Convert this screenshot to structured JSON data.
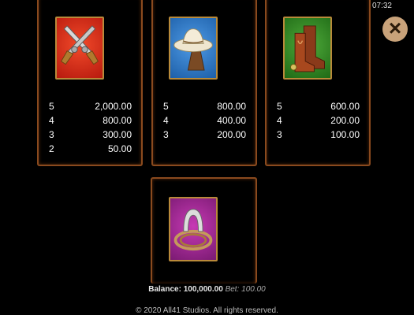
{
  "status": {
    "time": "07:32"
  },
  "close_label": "×",
  "colors": {
    "panel_border": "#8a4a1e",
    "close_bg": "#c8a27a"
  },
  "panels": [
    {
      "symbol": "crossed-pistols-icon",
      "payouts": [
        {
          "count": "5",
          "value": "2,000.00"
        },
        {
          "count": "4",
          "value": "800.00"
        },
        {
          "count": "3",
          "value": "300.00"
        },
        {
          "count": "2",
          "value": "50.00"
        }
      ]
    },
    {
      "symbol": "cowboy-hat-icon",
      "payouts": [
        {
          "count": "5",
          "value": "800.00"
        },
        {
          "count": "4",
          "value": "400.00"
        },
        {
          "count": "3",
          "value": "200.00"
        }
      ]
    },
    {
      "symbol": "cowboy-boots-icon",
      "payouts": [
        {
          "count": "5",
          "value": "600.00"
        },
        {
          "count": "4",
          "value": "200.00"
        },
        {
          "count": "3",
          "value": "100.00"
        }
      ]
    },
    {
      "symbol": "horseshoe-lasso-icon",
      "payouts": []
    }
  ],
  "footer": {
    "balance_label": "Balance:",
    "balance_value": "100,000.00",
    "bet_label": "Bet:",
    "bet_value": "100.00",
    "copyright": "© 2020 All41 Studios. All rights reserved."
  }
}
